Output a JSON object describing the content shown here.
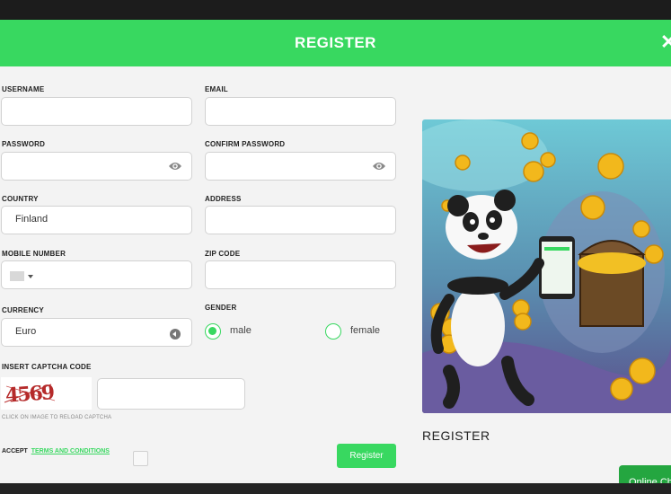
{
  "header": {
    "title": "REGISTER",
    "close_icon": "close-icon"
  },
  "form": {
    "username": {
      "label": "USERNAME",
      "value": ""
    },
    "email": {
      "label": "EMAIL",
      "value": ""
    },
    "password": {
      "label": "PASSWORD",
      "value": ""
    },
    "confirm_password": {
      "label": "CONFIRM PASSWORD",
      "value": ""
    },
    "country": {
      "label": "COUNTRY",
      "value": "Finland"
    },
    "address": {
      "label": "ADDRESS",
      "value": ""
    },
    "mobile": {
      "label": "MOBILE NUMBER",
      "value": ""
    },
    "zip": {
      "label": "ZIP CODE",
      "value": ""
    },
    "currency": {
      "label": "CURRENCY",
      "value": "Euro"
    },
    "gender": {
      "label": "GENDER",
      "options": [
        "male",
        "female"
      ],
      "selected": "male"
    },
    "captcha": {
      "label": "INSERT CAPTCHA CODE",
      "code": "4569",
      "hint": "CLICK ON IMAGE TO RELOAD CAPTCHA",
      "value": ""
    },
    "accept": {
      "prefix": "ACCEPT",
      "link": "TERMS AND CONDITIONS",
      "checked": false
    },
    "submit_label": "Register"
  },
  "side": {
    "title": "REGISTER"
  },
  "chat": {
    "label": "Online Chat"
  },
  "colors": {
    "accent": "#38d860",
    "chat": "#24a640",
    "background": "#f3f3f3"
  }
}
